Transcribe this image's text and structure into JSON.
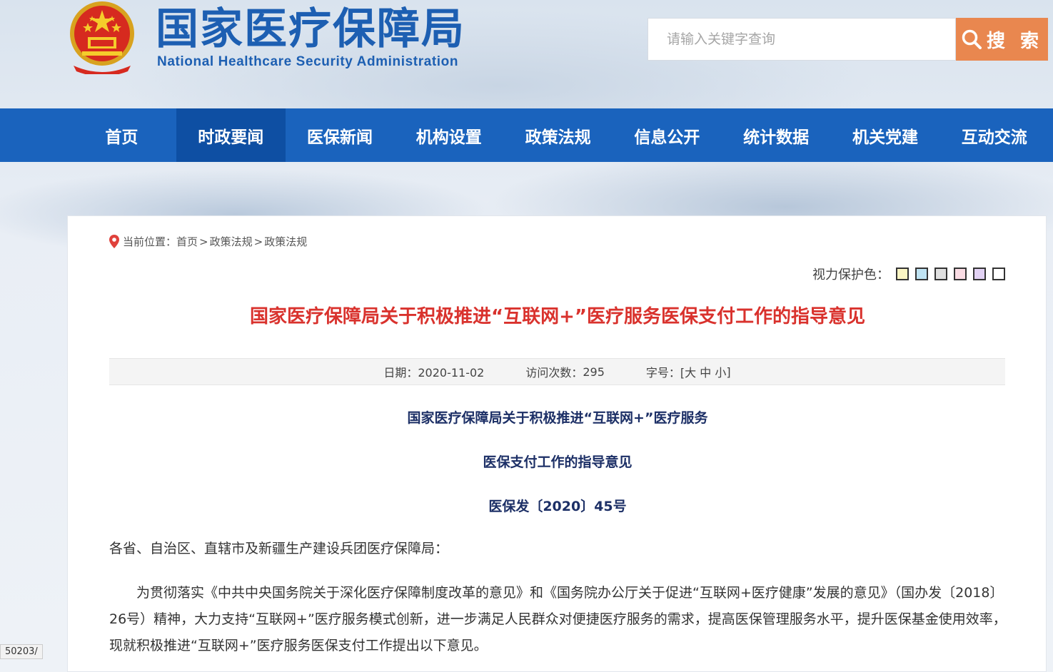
{
  "header": {
    "logo_cn": "国家医疗保障局",
    "logo_en": "National Healthcare Security Administration"
  },
  "search": {
    "placeholder": "请输入关键字查询",
    "button_label": "搜 索"
  },
  "nav": {
    "items": [
      {
        "label": "首页",
        "active": false
      },
      {
        "label": "时政要闻",
        "active": true
      },
      {
        "label": "医保新闻",
        "active": false
      },
      {
        "label": "机构设置",
        "active": false
      },
      {
        "label": "政策法规",
        "active": false
      },
      {
        "label": "信息公开",
        "active": false
      },
      {
        "label": "统计数据",
        "active": false
      },
      {
        "label": "机关党建",
        "active": false
      },
      {
        "label": "互动交流",
        "active": false
      }
    ]
  },
  "breadcrumb": {
    "prefix": "当前位置：",
    "items": [
      "首页",
      "政策法规",
      "政策法规"
    ],
    "sep": ">"
  },
  "eye_care": {
    "label": "视力保护色：",
    "swatches": [
      "#fbf5c3",
      "#bfe3f3",
      "#e0e0e0",
      "#fadce4",
      "#e2d2f4",
      "#ffffff"
    ]
  },
  "article": {
    "title": "国家医疗保障局关于积极推进“互联网+”医疗服务医保支付工作的指导意见",
    "date_label": "日期：2020-11-02",
    "views_label": "访问次数：",
    "views": "295",
    "font_label": "字号：[ ",
    "font_large": "大",
    "font_medium": "中",
    "font_small": "小",
    "font_end": " ]",
    "heading_line1": "国家医疗保障局关于积极推进“互联网+”医疗服务",
    "heading_line2": "医保支付工作的指导意见",
    "doc_number": "医保发〔2020〕45号",
    "salutation": "各省、自治区、直辖市及新疆生产建设兵团医疗保障局：",
    "body": "为贯彻落实《中共中央国务院关于深化医疗保障制度改革的意见》和《国务院办公厅关于促进“互联网+医疗健康”发展的意见》（国办发〔2018〕26号）精神，大力支持“互联网+”医疗服务模式创新，进一步满足人民群众对便捷医疗服务的需求，提高医保管理服务水平，提升医保基金使用效率，现就积极推进“互联网+”医疗服务医保支付工作提出以下意见。"
  },
  "status_tip": "50203/",
  "colors": {
    "nav_bg": "#1a63bd",
    "nav_active": "#0e4fa3",
    "search_btn": "#e9874f",
    "title_red": "#d9322d",
    "heading_navy": "#1c2f66",
    "logo_blue": "#1d5fb2"
  }
}
